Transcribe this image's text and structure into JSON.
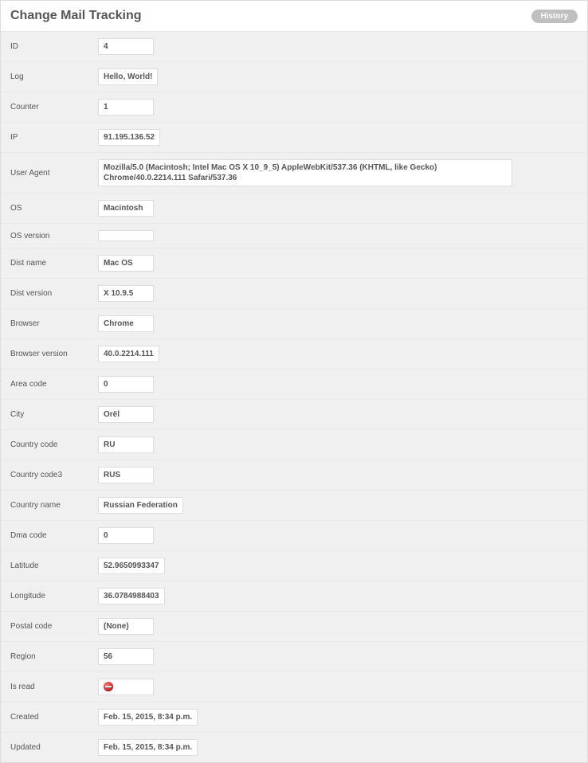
{
  "header": {
    "title": "Change Mail Tracking",
    "history_label": "History"
  },
  "fields": [
    {
      "label": "ID",
      "value": "4"
    },
    {
      "label": "Log",
      "value": "Hello, World!"
    },
    {
      "label": "Counter",
      "value": "1"
    },
    {
      "label": "IP",
      "value": "91.195.136.52"
    },
    {
      "label": "User Agent",
      "value": "Mozilla/5.0 (Macintosh; Intel Mac OS X 10_9_5) AppleWebKit/537.36 (KHTML, like Gecko) Chrome/40.0.2214.111 Safari/537.36",
      "wide": true
    },
    {
      "label": "OS",
      "value": "Macintosh"
    },
    {
      "label": "OS version",
      "value": "",
      "empty": true
    },
    {
      "label": "Dist name",
      "value": "Mac OS"
    },
    {
      "label": "Dist version",
      "value": "X 10.9.5"
    },
    {
      "label": "Browser",
      "value": "Chrome"
    },
    {
      "label": "Browser version",
      "value": "40.0.2214.111"
    },
    {
      "label": "Area code",
      "value": "0"
    },
    {
      "label": "City",
      "value": "Orël"
    },
    {
      "label": "Country code",
      "value": "RU"
    },
    {
      "label": "Country code3",
      "value": "RUS"
    },
    {
      "label": "Country name",
      "value": "Russian Federation"
    },
    {
      "label": "Dma code",
      "value": "0"
    },
    {
      "label": "Latitude",
      "value": "52.9650993347"
    },
    {
      "label": "Longitude",
      "value": "36.0784988403"
    },
    {
      "label": "Postal code",
      "value": "(None)"
    },
    {
      "label": "Region",
      "value": "56"
    },
    {
      "label": "Is read",
      "value": "",
      "icon": "minus",
      "narrow": true
    },
    {
      "label": "Created",
      "value": "Feb. 15, 2015, 8:34 p.m."
    },
    {
      "label": "Updated",
      "value": "Feb. 15, 2015, 8:34 p.m."
    }
  ]
}
